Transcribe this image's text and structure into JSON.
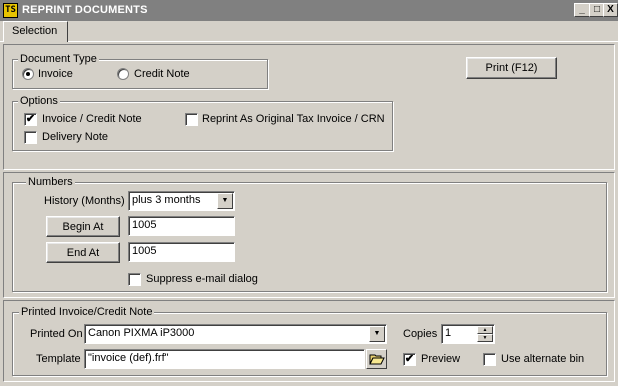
{
  "window": {
    "title": "REPRINT DOCUMENTS",
    "icon": "ts-app-icon",
    "min_label": "_",
    "max_label": "□",
    "close_label": "X"
  },
  "tab": {
    "label": "Selection"
  },
  "doc_type": {
    "title": "Document Type",
    "invoice_label": "Invoice",
    "credit_label": "Credit Note",
    "selected": "Invoice"
  },
  "print_button": "Print  (F12)",
  "options": {
    "title": "Options",
    "invoice_credit_label": "Invoice / Credit Note",
    "invoice_credit_checked": true,
    "delivery_label": "Delivery Note",
    "delivery_checked": false,
    "reprint_label": "Reprint As Original Tax Invoice / CRN",
    "reprint_checked": false
  },
  "numbers": {
    "title": "Numbers",
    "history_label": "History (Months)",
    "history_value": "plus 3 months",
    "begin_button": "Begin At",
    "begin_value": "1005",
    "end_button": "End At",
    "end_value": "1005",
    "suppress_label": "Suppress e-mail dialog",
    "suppress_checked": false
  },
  "printed": {
    "title": "Printed Invoice/Credit Note",
    "printed_on_label": "Printed On",
    "printer_value": "Canon PIXMA iP3000",
    "copies_label": "Copies",
    "copies_value": "1",
    "template_label": "Template",
    "template_value": "\"invoice (def).frf\"",
    "preview_label": "Preview",
    "preview_checked": true,
    "alt_bin_label": "Use alternate bin",
    "alt_bin_checked": false
  },
  "glyphs": {
    "check": "✔",
    "down": "▼",
    "up": "▲"
  }
}
